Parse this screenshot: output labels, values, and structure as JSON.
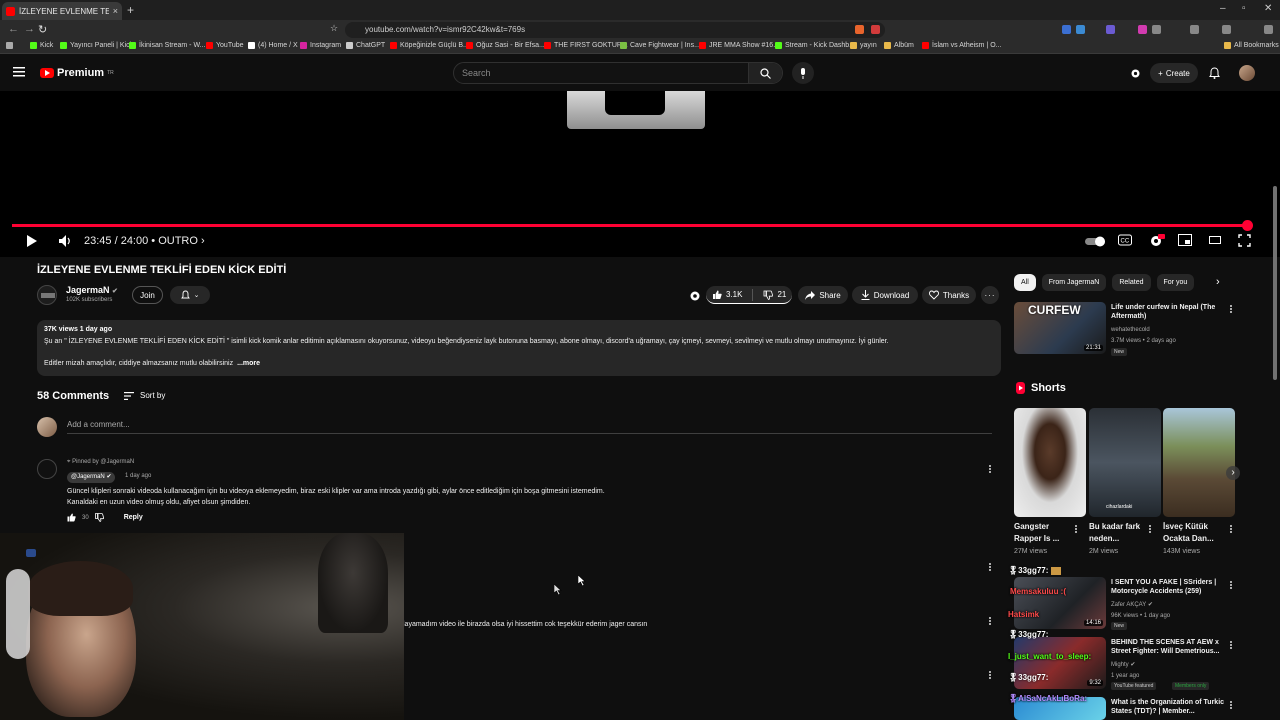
{
  "browser": {
    "tab_title": "İZLEYENE EVLENME TEKLİFİ EDE",
    "url": "youtube.com/watch?v=ismr92C42kw&t=769s",
    "bookmarks": [
      {
        "label": "Kick",
        "color": "#53fc18"
      },
      {
        "label": "Yayıncı Paneli | Kick",
        "color": "#53fc18"
      },
      {
        "label": "İkinisan Stream - W...",
        "color": "#53fc18"
      },
      {
        "label": "YouTube",
        "color": "#ff0000"
      },
      {
        "label": "(4) Home / X",
        "color": "#ffffff"
      },
      {
        "label": "Instagram",
        "color": "#d6249f"
      },
      {
        "label": "ChatGPT",
        "color": "#cccccc"
      },
      {
        "label": "Köpeğinizle Güçlü B...",
        "color": "#ff0000"
      },
      {
        "label": "Oğuz Sasi - Bir Efsa...",
        "color": "#ff0000"
      },
      {
        "label": "THE FIRST GOKTUR...",
        "color": "#ff0000"
      },
      {
        "label": "Cave Fightwear | Ins...",
        "color": "#7bc043"
      },
      {
        "label": "JRE MMA Show #16...",
        "color": "#ff0000"
      },
      {
        "label": "Stream - Kick Dashb...",
        "color": "#53fc18"
      },
      {
        "label": "yayın",
        "color": "#e8b84a"
      },
      {
        "label": "Albüm",
        "color": "#e8b84a"
      },
      {
        "label": "İslam vs Atheism | O...",
        "color": "#ff0000"
      }
    ],
    "all_bookmarks": "All Bookmarks"
  },
  "header": {
    "logo": "Premium",
    "logo_sup": "TR",
    "search_placeholder": "Search",
    "create_label": "Create"
  },
  "player": {
    "time": "23:45 / 24:00",
    "chapter": "• OUTRO ›",
    "progress_fraction": 0.99
  },
  "video": {
    "title": "İZLEYENE EVLENME TEKLİFİ EDEN KİCK EDİTİ",
    "channel": "JagermaN",
    "subscribers": "102K subscribers",
    "join": "Join",
    "likes": "3.1K",
    "dislikes": "21",
    "share": "Share",
    "download": "Download",
    "thanks": "Thanks",
    "description": {
      "meta": "37K views  1 day ago",
      "line1": "Şu an \" İZLEYENE EVLENME TEKLİFİ EDEN KİCK EDİTİ \" isimli kick komik anlar editimin açıklamasını okuyorsunuz, videoyu beğendiyseniz layk butonuna basmayı, abone olmayı, discord'a uğramayı, çay içmeyi, sevmeyi, sevilmeyi ve mutlu olmayı unutmayınız. İyi günler.",
      "line2": "Editler mizah amaçlıdır, ciddiye almazsanız mutlu olabilirsiniz",
      "more": "...more"
    }
  },
  "comments": {
    "count": "58 Comments",
    "sort_by": "Sort by",
    "add_placeholder": "Add a comment...",
    "pinned": {
      "pinned_by": "Pinned by @JagermaN",
      "author": "@JagermaN",
      "time": "1 day ago",
      "line1": "Güncel klipleri sonraki videoda kullanacağım için bu videoya eklemeyedim, biraz eski klipler var ama introda yazdığı gibi, aylar önce editlediğim için boşa gitmesini istemedim.",
      "line2": "Kanaldaki en uzun video olmuş oldu, afiyet olsun şimdiden.",
      "likes": "30",
      "reply": "Reply"
    },
    "partial_comment": "layamadım video ile birazda olsa iyi hissettim cok teşekkür ederim jager cansın"
  },
  "sidebar": {
    "chips": [
      "All",
      "From JagermaN",
      "Related",
      "For you"
    ],
    "related_top": {
      "thumb_text": "CURFEW",
      "duration": "21:31",
      "title": "Life under curfew in Nepal (The Aftermath)",
      "channel": "wehatethecold",
      "meta": "3.7M views • 2 days ago",
      "badge": "New"
    },
    "shorts_heading": "Shorts",
    "shorts": [
      {
        "title": "Gangster Rapper Is ...",
        "views": "27M views"
      },
      {
        "title": "Bu kadar fark neden...",
        "views": "2M views",
        "thumb_text": "cihazlardaki"
      },
      {
        "title": "İsveç Kütük Ocakta Dan...",
        "views": "143M views"
      }
    ],
    "related": [
      {
        "title": "I SENT YOU A FAKE | SSriders | Motorcycle Accidents (259)",
        "channel": "Zafer AKÇAY",
        "meta": "96K views • 1 day ago",
        "badge": "New",
        "duration": "14:16"
      },
      {
        "title": "BEHIND THE SCENES AT AEW x Street Fighter: Will Demetrious...",
        "channel": "Mighty",
        "meta": "1 year ago",
        "badge": "YouTube featured",
        "badge2": "Members only",
        "duration": "9:32"
      },
      {
        "title": "What is the Organization of Turkic States (TDT)? | Member..."
      }
    ],
    "chat": [
      {
        "user": "33gg77:",
        "msg": "",
        "color": "#ffffff"
      },
      {
        "user": "",
        "msg": "Memsakuluu :(",
        "color": "#ff4b4b"
      },
      {
        "user": "",
        "msg": "Hatsimk",
        "color": "#ff4b4b"
      },
      {
        "user": "33gg77:",
        "msg": "",
        "color": "#ffffff"
      },
      {
        "user": "",
        "msg": "I_just_want_to_sleep:",
        "color": "#53fc18"
      },
      {
        "user": "33gg77:",
        "msg": "",
        "color": "#ffffff"
      },
      {
        "user": "",
        "msg": "AlSaNcAkLıBoRa:",
        "color": "#b48cff"
      }
    ]
  }
}
